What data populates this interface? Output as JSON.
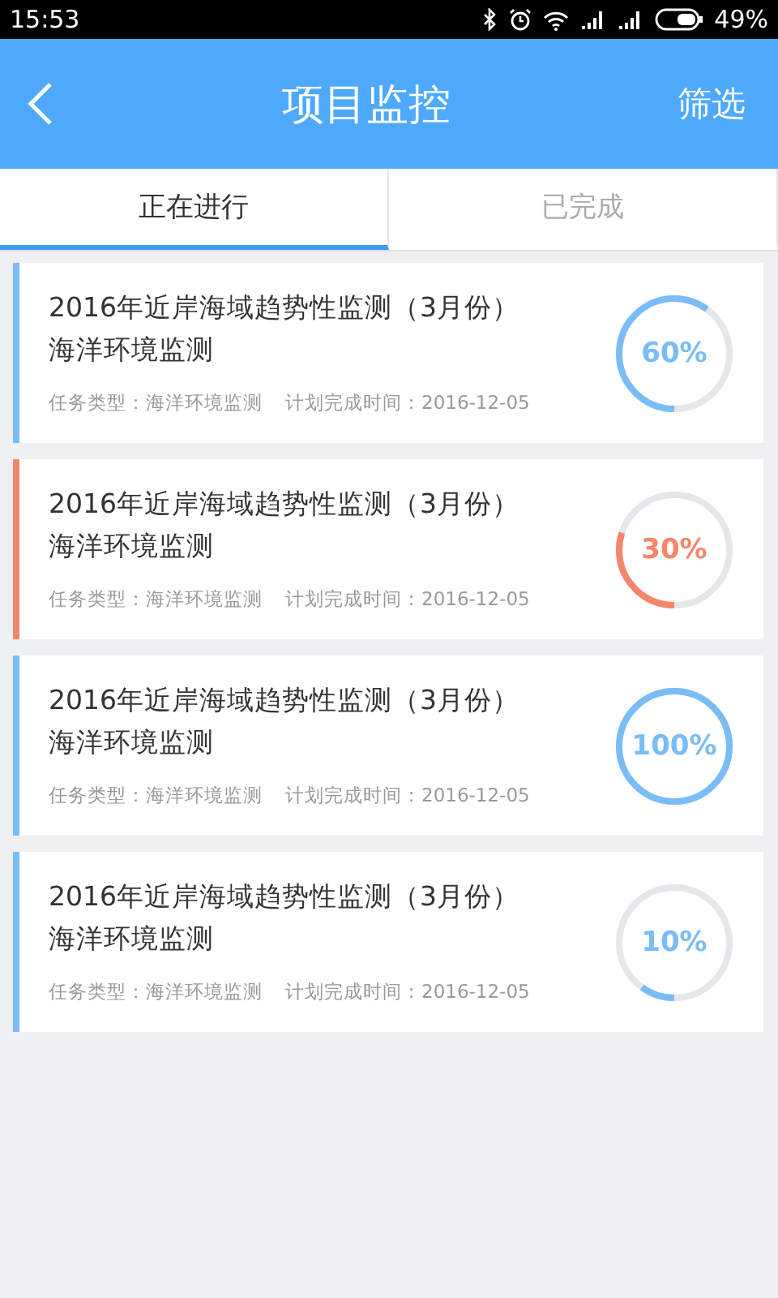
{
  "status_bar": {
    "time": "15:53",
    "battery_percent": "49%"
  },
  "header": {
    "title": "项目监控",
    "action": "筛选"
  },
  "tabs": [
    {
      "label": "正在进行",
      "selected": true
    },
    {
      "label": "已完成",
      "selected": false
    }
  ],
  "projects": [
    {
      "title": "2016年近岸海域趋势性监测（3月份）",
      "subtitle": "海洋环境监测",
      "task_type": "任务类型：海洋环境监测",
      "planned_date": "计划完成时间：2016-12-05",
      "percent": "60%",
      "level": 0.6,
      "color": "#79bcf8"
    },
    {
      "title": "2016年近岸海域趋势性监测（3月份）",
      "subtitle": "海洋环境监测",
      "task_type": "任务类型：海洋环境监测",
      "planned_date": "计划完成时间：2016-12-05",
      "percent": "30%",
      "level": 0.3,
      "color": "#f5866a"
    },
    {
      "title": "2016年近岸海域趋势性监测（3月份）",
      "subtitle": "海洋环境监测",
      "task_type": "任务类型：海洋环境监测",
      "planned_date": "计划完成时间：2016-12-05",
      "percent": "100%",
      "level": 1.0,
      "color": "#79bcf8"
    },
    {
      "title": "2016年近岸海域趋势性监测（3月份）",
      "subtitle": "海洋环境监测",
      "task_type": "任务类型：海洋环境监测",
      "planned_date": "计划完成时间：2016-12-05",
      "percent": "10%",
      "level": 0.1,
      "color": "#79bcf8"
    }
  ]
}
